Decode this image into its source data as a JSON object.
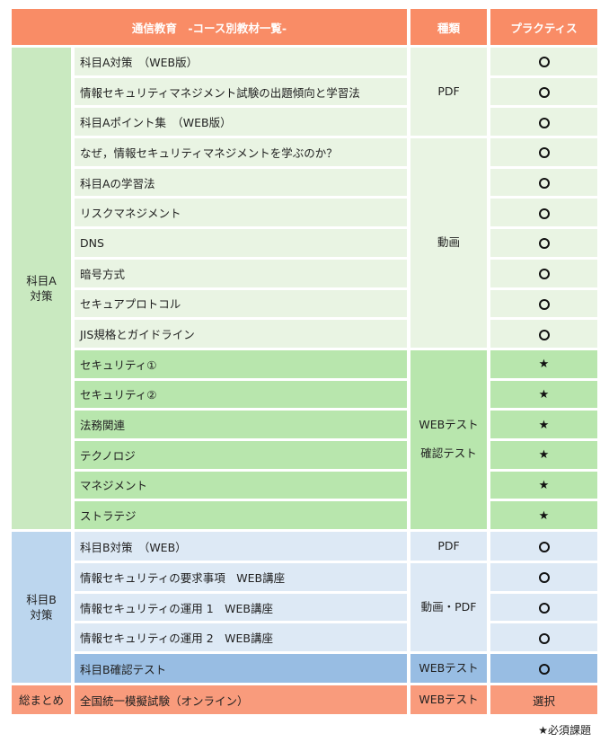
{
  "header": {
    "title": "通信教育　-コース別教材一覧-",
    "kind": "種類",
    "practice": "プラクティス"
  },
  "groups": {
    "a": "科目A\n対策",
    "b": "科目B\n対策",
    "summary": "総まとめ"
  },
  "kinds": {
    "pdf": "PDF",
    "video": "動画",
    "webtest": "WEBテスト",
    "confirm": "確認テスト",
    "video_pdf": "動画・PDF",
    "b_test": "WEBテスト",
    "mock": "WEBテスト"
  },
  "items": [
    {
      "label": "科目A対策　（WEB版）",
      "practice": "circle"
    },
    {
      "label": "情報セキュリティマネジメント試験の出題傾向と学習法",
      "practice": "circle"
    },
    {
      "label": "科目Aポイント集　（WEB版）",
      "practice": "circle"
    },
    {
      "label": "なぜ，情報セキュリティマネジメントを学ぶのか？",
      "practice": "circle"
    },
    {
      "label": "科目Aの学習法",
      "practice": "circle"
    },
    {
      "label": "リスクマネジメント",
      "practice": "circle"
    },
    {
      "label": "DNS",
      "practice": "circle"
    },
    {
      "label": "暗号方式",
      "practice": "circle"
    },
    {
      "label": "セキュアプロトコル",
      "practice": "circle"
    },
    {
      "label": "JIS規格とガイドライン",
      "practice": "circle"
    },
    {
      "label": "セキュリティ①",
      "practice": "star"
    },
    {
      "label": "セキュリティ②",
      "practice": "star"
    },
    {
      "label": "法務関連",
      "practice": "star"
    },
    {
      "label": "テクノロジ",
      "practice": "star"
    },
    {
      "label": "マネジメント",
      "practice": "star"
    },
    {
      "label": "ストラテジ",
      "practice": "star"
    },
    {
      "label": "科目B対策　（WEB）",
      "practice": "circle"
    },
    {
      "label": "情報セキュリティの要求事項　WEB講座",
      "practice": "circle"
    },
    {
      "label": "情報セキュリティの運用 1　WEB講座",
      "practice": "circle"
    },
    {
      "label": "情報セキュリティの運用 2　WEB講座",
      "practice": "circle"
    },
    {
      "label": "科目B確認テスト",
      "practice": "circle"
    },
    {
      "label": "全国統一模擬試験（オンライン）",
      "practice": "選択"
    }
  ],
  "symbols": {
    "star": "★"
  },
  "footnote": "★必須課題",
  "colors": {
    "header": "#f98c66",
    "groupA": "#c9e9c0",
    "rowA_light": "#e9f4e3",
    "rowA_test": "#b8e6ad",
    "groupB": "#bcd6ee",
    "rowB_light": "#dde9f5",
    "rowB_test": "#98bde3",
    "summary": "#f99b7c"
  }
}
